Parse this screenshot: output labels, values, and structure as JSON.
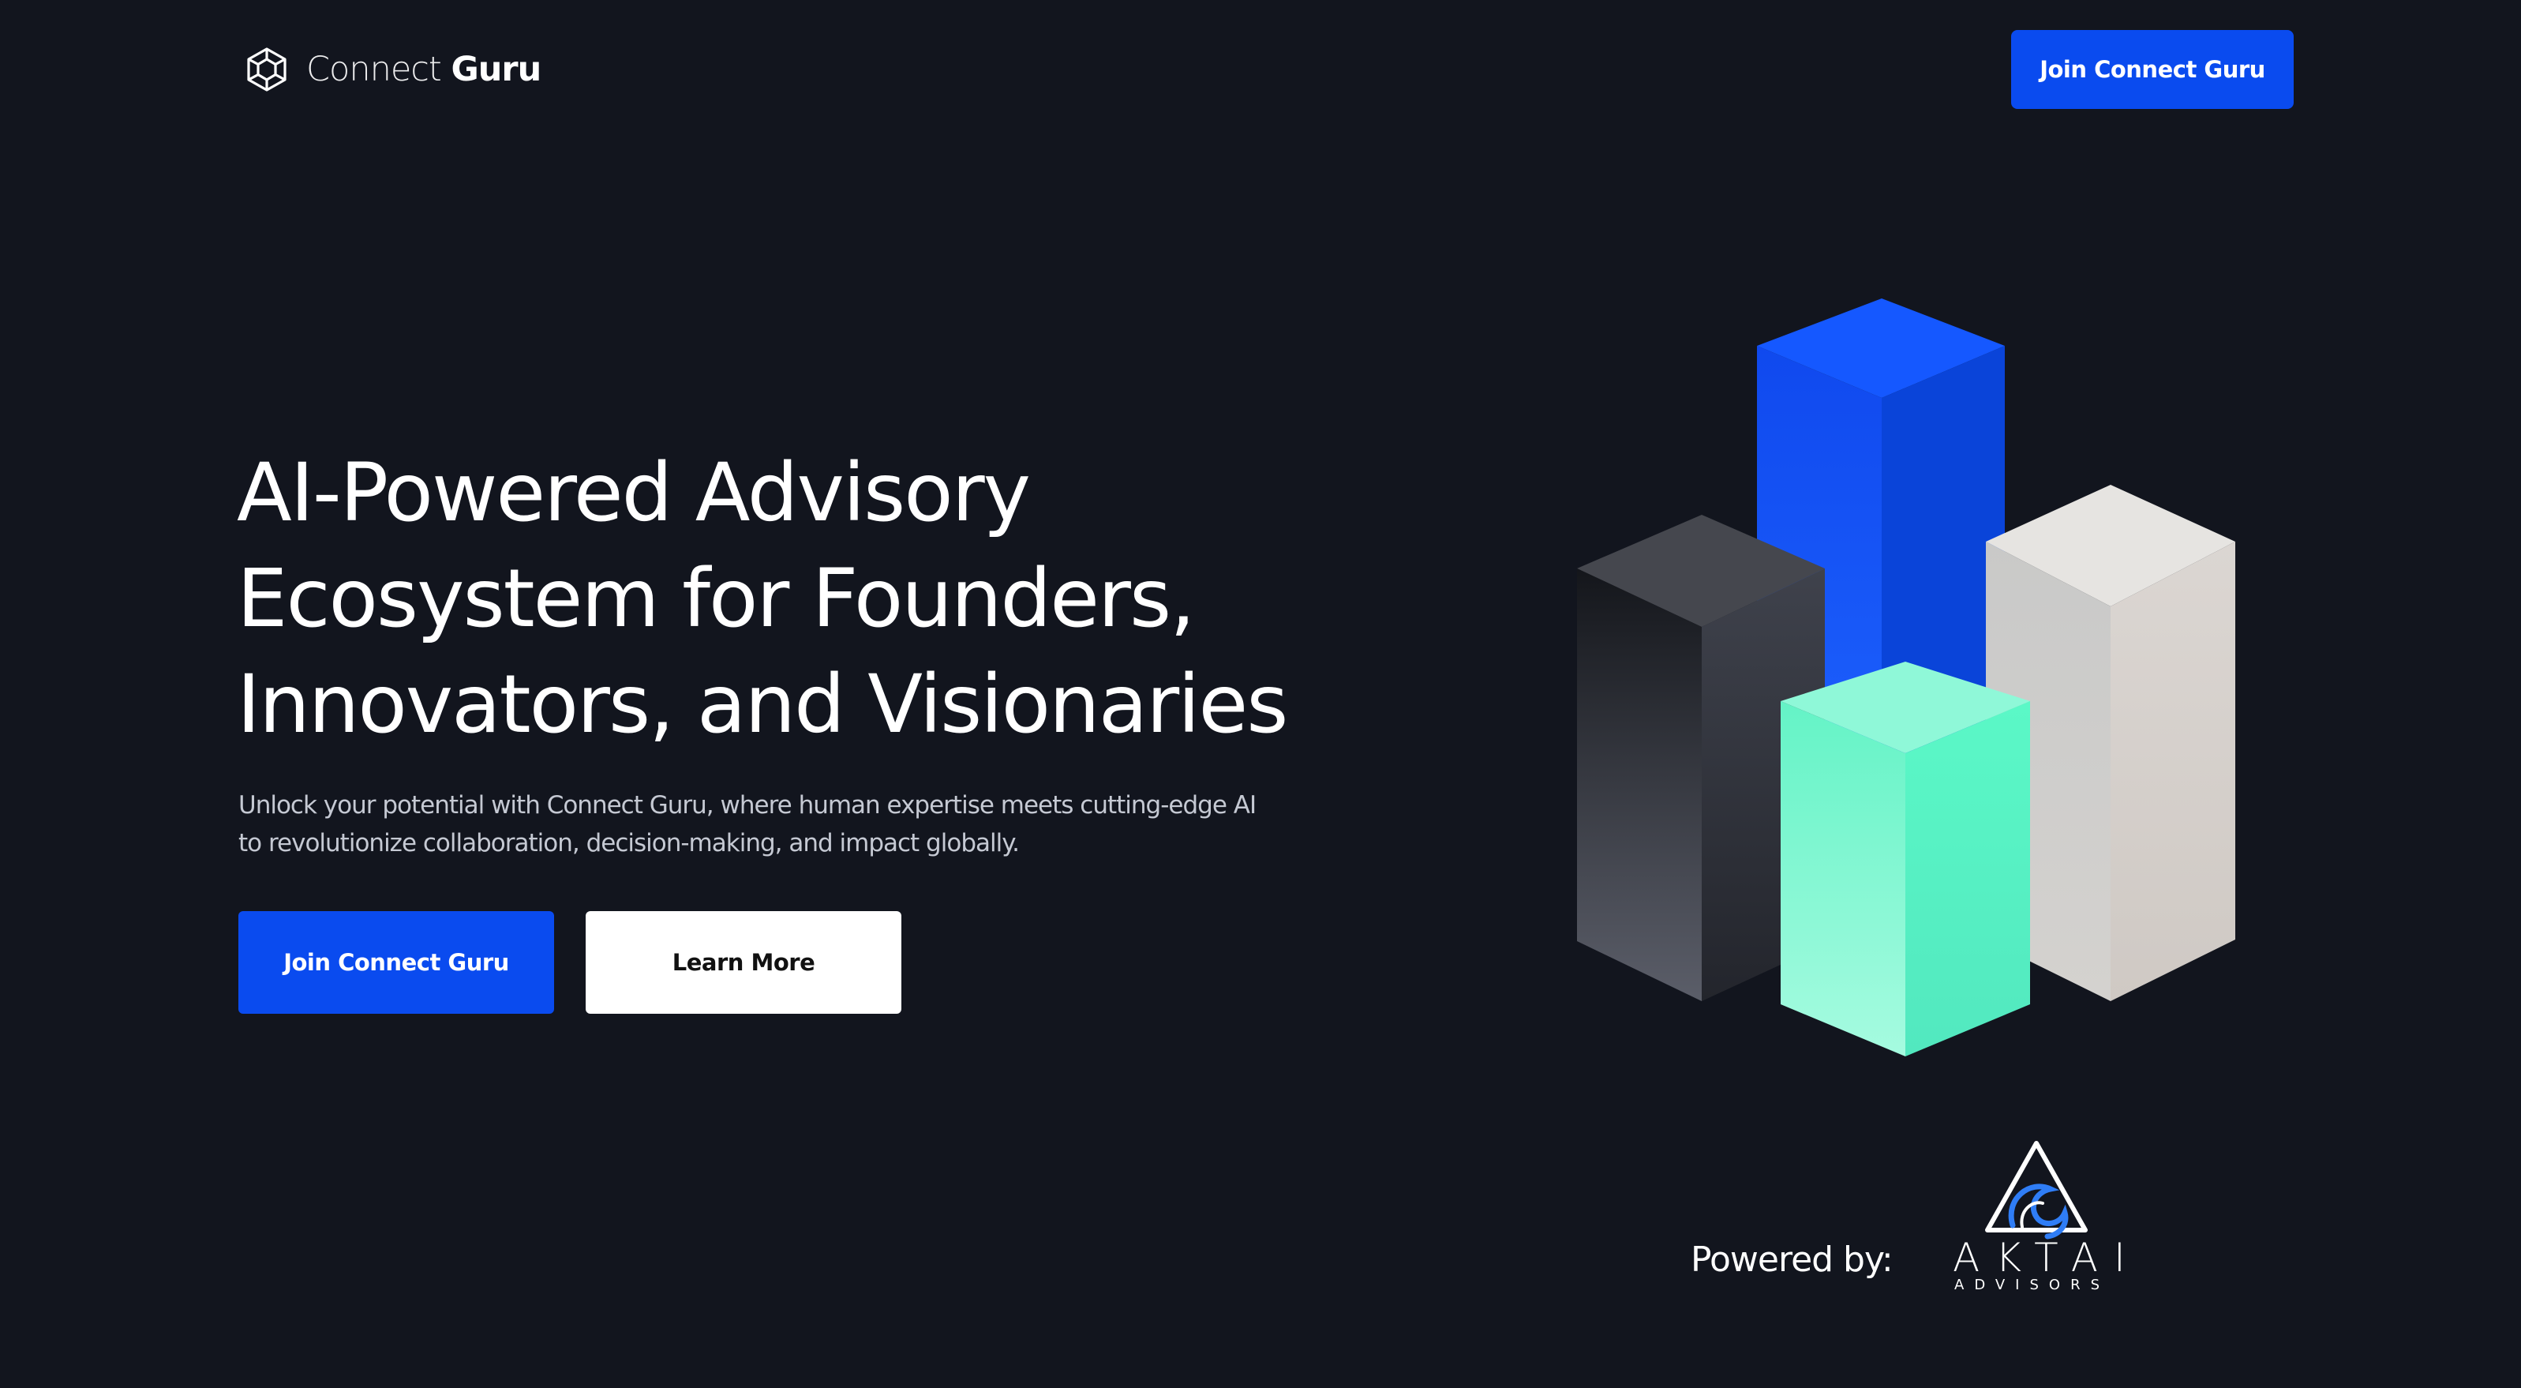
{
  "header": {
    "brand_light": "Connect",
    "brand_bold": "Guru",
    "logo_icon": "cube-icon",
    "cta_label": "Join Connect Guru"
  },
  "hero": {
    "title_lines": [
      "AI-Powered Advisory",
      "Ecosystem for Founders,",
      "Innovators, and Visionaries"
    ],
    "subtitle_lines": [
      "Unlock your potential with Connect Guru, where human expertise meets cutting-edge AI",
      "to revolutionize collaboration, decision-making, and impact globally."
    ],
    "primary_cta": "Join Connect Guru",
    "secondary_cta": "Learn More"
  },
  "illustration": {
    "name": "isometric-bars-illustration",
    "colors": {
      "blue": "#0d4df0",
      "dark_gray": "#3a3d45",
      "mint": "#5ef7c8",
      "light_gray": "#d9d6d1"
    }
  },
  "powered_by": {
    "label": "Powered by:",
    "partner_name": "AKTAI",
    "partner_sub": "ADVISORS",
    "partner_icon": "triangle-wave-icon"
  },
  "colors": {
    "background": "#12151e",
    "accent": "#0a4bef",
    "text": "#ffffff",
    "muted_text": "#c5c9d3"
  }
}
